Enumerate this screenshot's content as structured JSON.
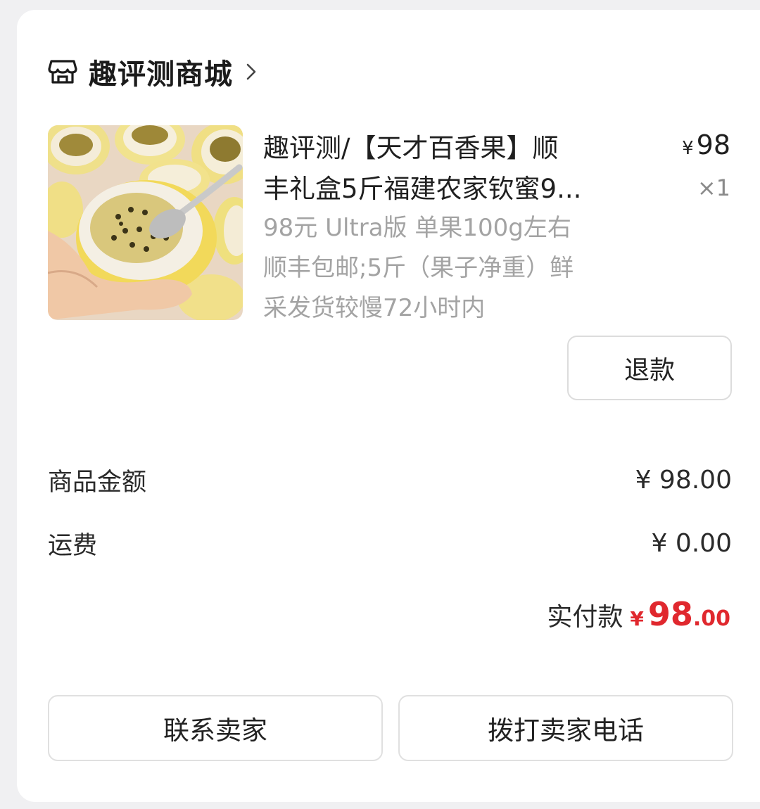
{
  "shop": {
    "name": "趣评测商城",
    "icon": "store-icon"
  },
  "product": {
    "title_line1": "趣评测/【天才百香果】顺",
    "title_line2": "丰礼盒5斤福建农家钦蜜9...",
    "spec_line1": "98元 Ultra版 单果100g左右",
    "spec_line2": "顺丰包邮;5斤（果子净重）鲜",
    "spec_line3": "采发货较慢72小时内",
    "price_symbol": "¥",
    "price": "98",
    "quantity": "×1",
    "image": "passion-fruit-image"
  },
  "actions": {
    "refund": "退款",
    "contact_seller": "联系卖家",
    "call_seller": "拨打卖家电话"
  },
  "summary": {
    "goods_label": "商品金额",
    "goods_amount": "¥ 98.00",
    "shipping_label": "运费",
    "shipping_amount": "¥ 0.00",
    "paid_label": "实付款",
    "paid_symbol": "¥",
    "paid_integer": "98",
    "paid_cents": ".00"
  },
  "colors": {
    "accent_red": "#e0282e",
    "card_bg": "#ffffff",
    "page_bg": "#f0f0f2"
  }
}
